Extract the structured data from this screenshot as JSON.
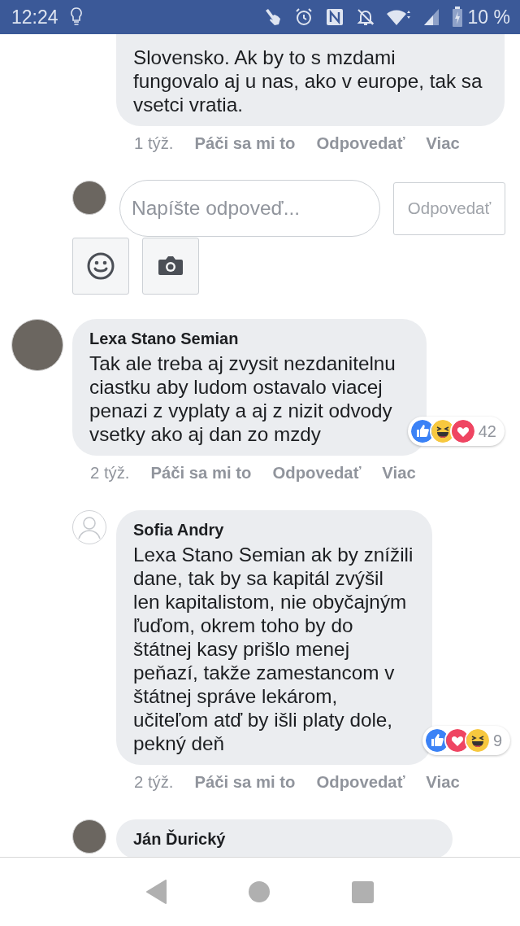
{
  "status_bar": {
    "time": "12:24",
    "battery": "10 %"
  },
  "thread": [
    {
      "kind": "reply",
      "text": "Slovensko. Ak by to s mzdami\nfungovalo aj u nas, ako v europe, tak sa vsetci vratia.",
      "time": "1 týž.",
      "actions": [
        "Páči sa mi to",
        "Odpovedať",
        "Viac"
      ]
    },
    {
      "kind": "composer",
      "avatar": {
        "kind": "photo"
      },
      "placeholder": "Napíšte odpoveď...",
      "button": "Odpovedať"
    },
    {
      "kind": "comment",
      "avatar": {
        "kind": "photo"
      },
      "author": "Lexa Stano Semian",
      "text": "Tak ale treba aj zvysit nezdanitelnu ciastku aby ludom ostavalo viacej penazi z vyplaty a aj z nizit odvody vsetky ako aj dan zo mzdy",
      "reactions": [
        {
          "kind": "like"
        },
        {
          "kind": "haha"
        },
        {
          "kind": "love"
        }
      ],
      "reaction_count": "42",
      "time": "2 týž.",
      "actions": [
        "Páči sa mi to",
        "Odpovedať",
        "Viac"
      ],
      "children": [
        {
          "kind": "reply",
          "avatar": {
            "kind": "silhouette"
          },
          "author": "Sofia Andry",
          "text": "Lexa Stano Semian ak by znížili dane, tak by sa kapitál zvýšil len kapitalistom, nie obyčajným ľuďom, okrem toho by do štátnej kasy prišlo menej peňazí, takže zamestancom v štátnej správe lekárom, učiteľom atď by išli platy dole, pekný deň",
          "reactions": [
            {
              "kind": "like"
            },
            {
              "kind": "love"
            },
            {
              "kind": "haha"
            }
          ],
          "reaction_count": "9",
          "time": "2 týž.",
          "actions": [
            "Páči sa mi to",
            "Odpovedať",
            "Viac"
          ]
        },
        {
          "kind": "reply",
          "avatar": {
            "kind": "photo"
          },
          "author": "Ján Ďurický"
        }
      ]
    }
  ]
}
